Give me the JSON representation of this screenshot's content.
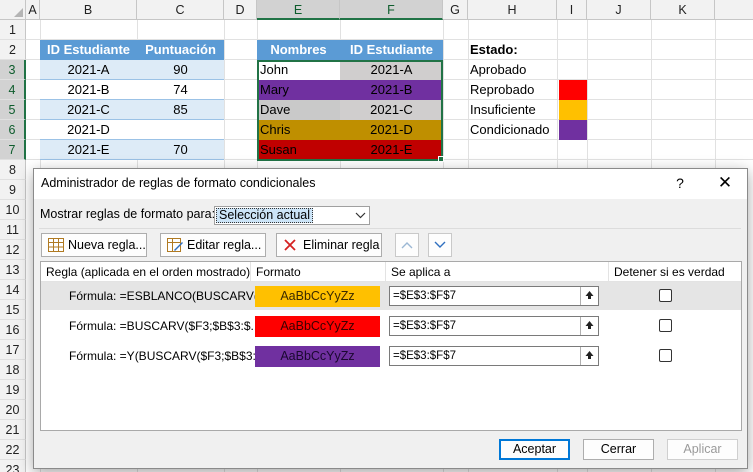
{
  "spreadsheet": {
    "columns": [
      "A",
      "B",
      "C",
      "D",
      "E",
      "F",
      "G",
      "H",
      "I",
      "J",
      "K"
    ],
    "rows": [
      "1",
      "2",
      "3",
      "4",
      "5",
      "6",
      "7",
      "8",
      "9",
      "10",
      "11",
      "12",
      "13",
      "14",
      "15",
      "16",
      "17",
      "18",
      "19",
      "20",
      "21",
      "22",
      "23"
    ],
    "table1": {
      "headers": [
        "ID Estudiante",
        "Puntuación"
      ],
      "rows": [
        [
          "2021-A",
          "90"
        ],
        [
          "2021-B",
          "74"
        ],
        [
          "2021-C",
          "85"
        ],
        [
          "2021-D",
          ""
        ],
        [
          "2021-E",
          "70"
        ]
      ]
    },
    "table2": {
      "headers": [
        "Nombres",
        "ID Estudiante"
      ],
      "rows": [
        [
          "John",
          "2021-A"
        ],
        [
          "Mary",
          "2021-B"
        ],
        [
          "Dave",
          "2021-C"
        ],
        [
          "Chris",
          "2021-D"
        ],
        [
          "Susan",
          "2021-E"
        ]
      ],
      "row_fills": [
        "#ffffff",
        "#7030a0",
        "#c9c9c9",
        "#bf8f00",
        "#c00000"
      ],
      "id_fills": [
        "#d0cece",
        "#7030a0",
        "#d0cece",
        "#bf8f00",
        "#c00000"
      ]
    },
    "legend": {
      "title": "Estado:",
      "items": [
        {
          "label": "Aprobado",
          "color": ""
        },
        {
          "label": "Reprobado",
          "color": "#ff0000"
        },
        {
          "label": "Insuficiente",
          "color": "#ffc000"
        },
        {
          "label": "Condicionado",
          "color": "#7030a0"
        }
      ]
    }
  },
  "dialog": {
    "title": "Administrador de reglas de formato condicionales",
    "help": "?",
    "close": "✕",
    "show_rules_label": "Mostrar reglas de formato para:",
    "show_rules_value": "Selección actual",
    "buttons": {
      "new_rule": "Nueva regla...",
      "edit_rule": "Editar regla...",
      "delete_rule": "Eliminar regla"
    },
    "columns": [
      "Regla (aplicada en el orden mostrado)",
      "Formato",
      "Se aplica a",
      "Detener si es verdad"
    ],
    "rules": [
      {
        "rule": "Fórmula: =ESBLANCO(BUSCARV(...",
        "format_sample": "AaBbCcYyZz",
        "format_bg": "#ffc000",
        "format_fg": "#3a2a00",
        "applies_to": "=$E$3:$F$7",
        "stop": false
      },
      {
        "rule": "Fórmula: =BUSCARV($F3;$B$3:$...",
        "format_sample": "AaBbCcYyZz",
        "format_bg": "#ff0000",
        "format_fg": "#3a0000",
        "applies_to": "=$E$3:$F$7",
        "stop": false
      },
      {
        "rule": "Fórmula: =Y(BUSCARV($F3;$B$3:...",
        "format_sample": "AaBbCcYyZz",
        "format_bg": "#7030a0",
        "format_fg": "#1a0830",
        "applies_to": "=$E$3:$F$7",
        "stop": false
      }
    ],
    "footer": {
      "ok": "Aceptar",
      "close": "Cerrar",
      "apply": "Aplicar"
    }
  }
}
